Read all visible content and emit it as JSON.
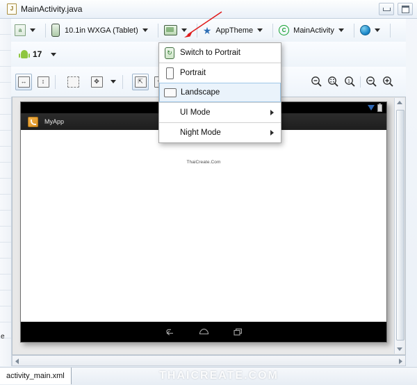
{
  "window": {
    "title": "MainActivity.java",
    "tab_icon": "java-file-icon",
    "minimize_label": "Minimize",
    "maximize_label": "Maximize"
  },
  "toolbar_main": {
    "config_label": "",
    "device": "10.1in WXGA (Tablet)",
    "orientation_icon": "orientation-landscape-icon",
    "theme": "AppTheme",
    "activity": "MainActivity",
    "locale_icon": "globe-icon"
  },
  "toolbar_api": {
    "api_level": "17",
    "android_icon": "android-robot-icon"
  },
  "toolbar_layout": {
    "buttons": [
      {
        "name": "match-width-button",
        "glyph": "↔",
        "active": true
      },
      {
        "name": "match-height-button",
        "glyph": "↕",
        "active": false
      },
      {
        "name": "show-outline-button",
        "glyph": "",
        "active": false
      },
      {
        "name": "distribute-button",
        "glyph": "✥",
        "active": false
      },
      {
        "name": "baseline-align-button",
        "glyph": "⇱",
        "active": true
      },
      {
        "name": "refresh-button",
        "glyph": "⟲",
        "active": false
      }
    ],
    "zoom_buttons": [
      {
        "name": "zoom-out-fit-icon",
        "glyph": "−"
      },
      {
        "name": "zoom-fit-best-icon",
        "glyph": "⁘"
      },
      {
        "name": "zoom-100-icon",
        "glyph": "1"
      },
      {
        "name": "zoom-out-icon",
        "glyph": "−"
      },
      {
        "name": "zoom-in-icon",
        "glyph": "+"
      }
    ]
  },
  "orientation_menu": {
    "items": [
      {
        "label": "Switch to Portrait",
        "icon": "rotate-icon",
        "selected": false,
        "submenu": false
      },
      {
        "label": "Portrait",
        "icon": "portrait-icon",
        "selected": false,
        "submenu": false
      },
      {
        "label": "Landscape",
        "icon": "landscape-icon",
        "selected": true,
        "submenu": false
      },
      {
        "label": "UI Mode",
        "icon": "",
        "selected": false,
        "submenu": true
      },
      {
        "label": "Night Mode",
        "icon": "",
        "selected": false,
        "submenu": true
      }
    ]
  },
  "preview": {
    "app_name": "MyApp",
    "content_text": "ThaiCreate.Com",
    "status_icons": [
      "wifi-icon",
      "battery-icon"
    ],
    "nav_buttons": [
      "back-icon",
      "home-icon",
      "recents-icon"
    ]
  },
  "bottom": {
    "tab_label": "activity_main.xml",
    "watermark": "THAICREATE.COM"
  },
  "colors": {
    "accent": "#2f6fb5",
    "android_green": "#8ec63f",
    "selection": "#eaf3fb",
    "arrow_red": "#e01b1b"
  }
}
